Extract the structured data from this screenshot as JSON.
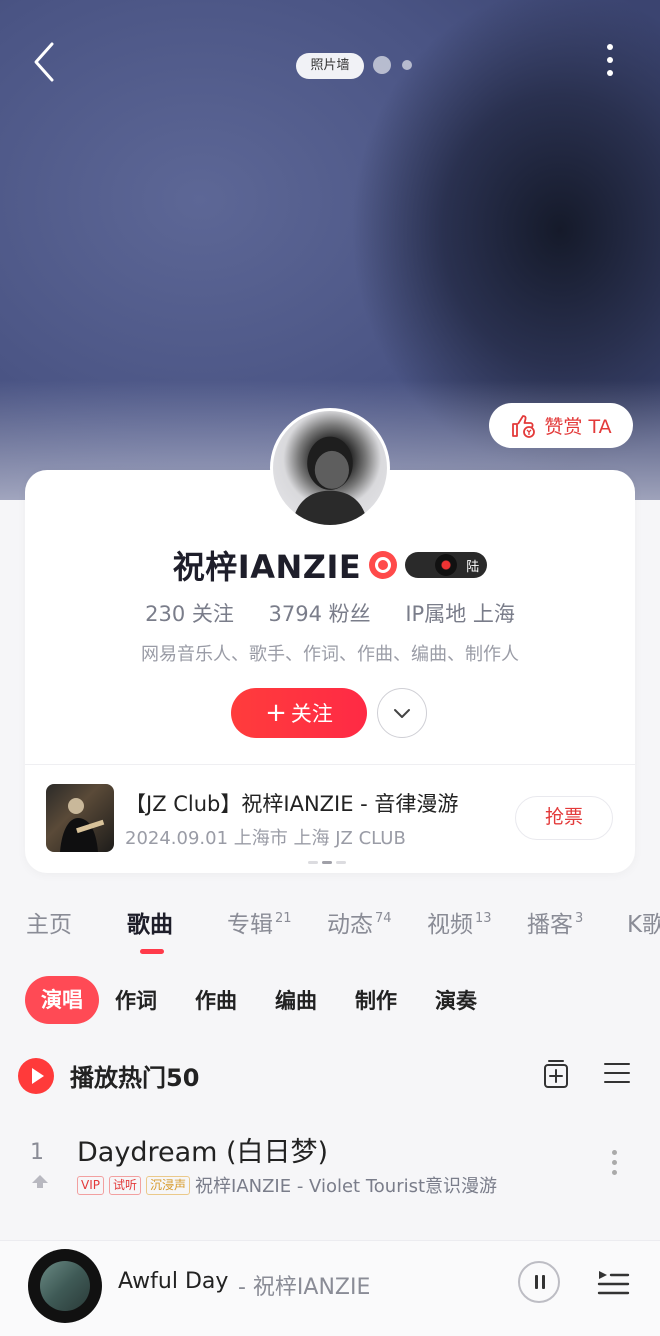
{
  "header": {
    "photo_wall_label": "照片墙"
  },
  "reward": {
    "label": "赞赏 TA"
  },
  "profile": {
    "name": "祝梓IANZIE",
    "badge_lu": "陆",
    "follows": "230 关注",
    "fans": "3794 粉丝",
    "ip": "IP属地 上海",
    "roles": "网易音乐人、歌手、作词、作曲、编曲、制作人",
    "follow_label": "关注"
  },
  "event": {
    "title": "【JZ Club】祝梓IANZIE - 音律漫游",
    "subtitle": "2024.09.01 上海市 上海 JZ CLUB",
    "ticket_label": "抢票"
  },
  "tabs": [
    {
      "label": "主页",
      "count": ""
    },
    {
      "label": "歌曲",
      "count": ""
    },
    {
      "label": "专辑",
      "count": "21"
    },
    {
      "label": "动态",
      "count": "74"
    },
    {
      "label": "视频",
      "count": "13"
    },
    {
      "label": "播客",
      "count": "3"
    },
    {
      "label": "K歌",
      "count": ""
    }
  ],
  "subtabs": [
    "演唱",
    "作词",
    "作曲",
    "编曲",
    "制作",
    "演奏"
  ],
  "hot": {
    "title": "播放热门50"
  },
  "songs": [
    {
      "rank": "1",
      "title": "Daydream (白日梦)",
      "tags": [
        "VIP",
        "试听",
        "沉浸声"
      ],
      "meta": "祝梓IANZIE - Violet Tourist意识漫游"
    }
  ],
  "player": {
    "title": "Awful Day",
    "artist": "- 祝梓IANZIE"
  },
  "colors": {
    "accent": "#ff3a3a"
  }
}
